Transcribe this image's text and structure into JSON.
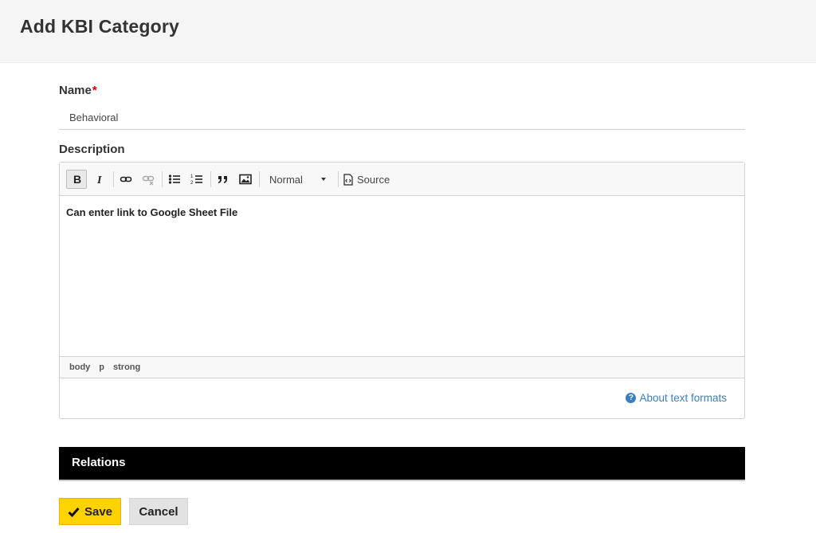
{
  "header": {
    "title": "Add KBI Category"
  },
  "form": {
    "name": {
      "label": "Name",
      "required_mark": "*",
      "value": "Behavioral"
    },
    "description": {
      "label": "Description",
      "toolbar": {
        "format_value": "Normal",
        "source_label": "Source"
      },
      "content": "Can enter link to Google Sheet File",
      "path": [
        "body",
        "p",
        "strong"
      ],
      "about_formats": "About text formats"
    }
  },
  "relations": {
    "title": "Relations"
  },
  "actions": {
    "save_label": "Save",
    "cancel_label": "Cancel"
  },
  "colors": {
    "accent_yellow": "#ffd200",
    "link_blue": "#3a7ec2",
    "required_red": "#e00000"
  }
}
